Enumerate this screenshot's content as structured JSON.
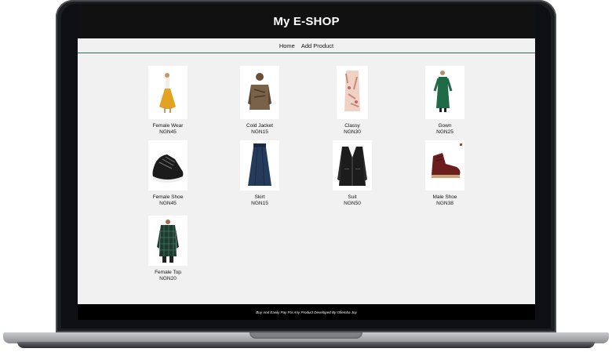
{
  "app": {
    "title": "My E-SHOP"
  },
  "nav": {
    "home": "Home",
    "add_product": "Add Product"
  },
  "products": [
    {
      "name": "Female Wear",
      "price": "NGN45",
      "icon": "yellow-dress-image"
    },
    {
      "name": "Cold Jacket",
      "price": "NGN15",
      "icon": "brown-jacket-image"
    },
    {
      "name": "Classy",
      "price": "NGN30",
      "icon": "floral-dress-image"
    },
    {
      "name": "Gown",
      "price": "NGN25",
      "icon": "green-gown-image"
    },
    {
      "name": "Female Shoe",
      "price": "NGN45",
      "icon": "black-sneaker-image"
    },
    {
      "name": "Skirt",
      "price": "NGN15",
      "icon": "navy-skirt-image"
    },
    {
      "name": "Suit",
      "price": "NGN50",
      "icon": "black-suit-image"
    },
    {
      "name": "Male Shoe",
      "price": "NGN38",
      "icon": "brown-boot-image"
    },
    {
      "name": "Female Top",
      "price": "NGN20",
      "icon": "plaid-top-image"
    }
  ],
  "footer": {
    "text": "Buy And Easily Pay For Any Product   Developed By Ofiemba Joy"
  },
  "colors": {
    "header_bg": "#111111",
    "nav_border": "#2e6b58",
    "page_bg": "#f1f1f1",
    "footer_bg": "#000000"
  }
}
